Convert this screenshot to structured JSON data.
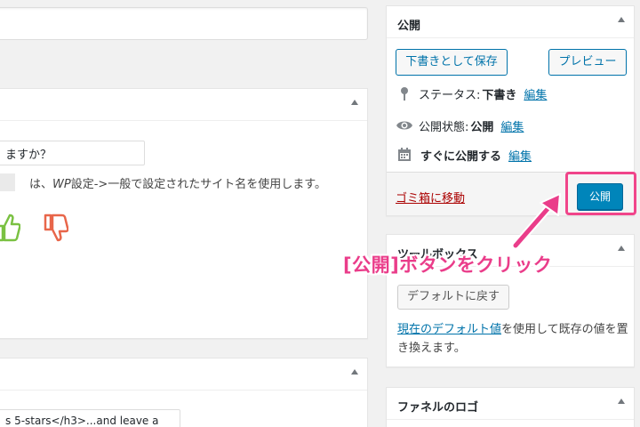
{
  "editor": {
    "title_value": "",
    "box1": {
      "question_value": "ますか？",
      "description_prefix": "は、",
      "description_wp": "WP",
      "description_suffix": "設定->一般で設定されたサイト名を使用します。"
    },
    "box2": {
      "code_value": "s 5-stars</h3>...and leave a"
    }
  },
  "publish": {
    "title": "公開",
    "save_draft_label": "下書きとして保存",
    "preview_label": "プレビュー",
    "status_label": "ステータス:",
    "status_value": "下書き",
    "visibility_label": "公開状態:",
    "visibility_value": "公開",
    "schedule_label": "すぐに公開する",
    "edit_label": "編集",
    "trash_label": "ゴミ箱に移動",
    "publish_label": "公開"
  },
  "toolbox": {
    "title": "ツールボックス",
    "reset_label": "デフォルトに戻す",
    "desc_link": "現在のデフォルト値",
    "desc_rest": "を使用して既存の値を置き換えます。"
  },
  "funnel": {
    "title": "ファネルのロゴ"
  },
  "annotation": {
    "text": "[公開]ボタンをクリック",
    "color": "#ea3d8a"
  },
  "colors": {
    "accent": "#0073aa",
    "publish_button": "#0085ba",
    "trash": "#a00000",
    "highlight": "#f0458a",
    "thumb_up": "#7ac142",
    "thumb_down": "#e8664a"
  }
}
